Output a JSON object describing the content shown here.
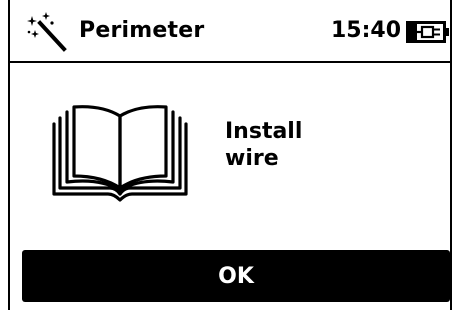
{
  "header": {
    "icon": "magic-wand-icon",
    "title": "Perimeter",
    "clock": "15:40",
    "battery_icon": "battery-plug-icon"
  },
  "content": {
    "icon": "open-book-icon",
    "message_lines": [
      "Install",
      "wire"
    ]
  },
  "actions": {
    "ok_label": "OK"
  },
  "colors": {
    "foreground": "#000000",
    "background": "#ffffff",
    "button_text": "#ffffff"
  }
}
